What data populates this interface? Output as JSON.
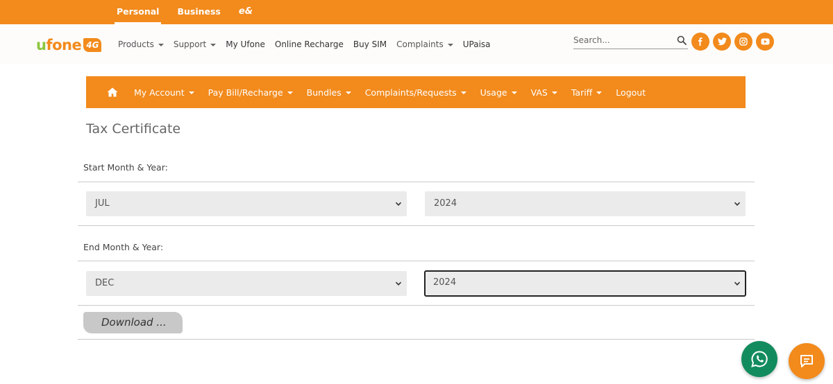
{
  "topbar": {
    "tabs": [
      {
        "label": "Personal"
      },
      {
        "label": "Business"
      },
      {
        "label": "e&"
      }
    ]
  },
  "header": {
    "logo": {
      "text_u": "u",
      "text_rest": "fone",
      "badge": "4G"
    },
    "nav": [
      {
        "label": "Products",
        "dropdown": true
      },
      {
        "label": "Support",
        "dropdown": true
      },
      {
        "label": "My Ufone",
        "dropdown": false
      },
      {
        "label": "Online Recharge",
        "dropdown": false
      },
      {
        "label": "Buy SIM",
        "dropdown": false
      },
      {
        "label": "Complaints",
        "dropdown": true
      },
      {
        "label": "UPaisa",
        "dropdown": false
      }
    ],
    "search": {
      "placeholder": "Search...",
      "icon": "search-icon"
    },
    "social": [
      "facebook-icon",
      "twitter-icon",
      "instagram-icon",
      "youtube-icon"
    ]
  },
  "account_nav": {
    "home_icon": "home-icon",
    "items": [
      {
        "label": "My Account",
        "dropdown": true
      },
      {
        "label": "Pay Bill/Recharge",
        "dropdown": true
      },
      {
        "label": "Bundles",
        "dropdown": true
      },
      {
        "label": "Complaints/Requests",
        "dropdown": true
      },
      {
        "label": "Usage",
        "dropdown": true
      },
      {
        "label": "VAS",
        "dropdown": true
      },
      {
        "label": "Tariff",
        "dropdown": true
      },
      {
        "label": "Logout",
        "dropdown": false
      }
    ]
  },
  "page": {
    "title": "Tax Certificate",
    "start_label": "Start Month & Year:",
    "start_month": "JUL",
    "start_year": "2024",
    "end_label": "End Month & Year:",
    "end_month": "DEC",
    "end_year": "2024",
    "download_label": "Download ..."
  },
  "colors": {
    "brand_orange": "#f28a1c",
    "whatsapp_green": "#128c5e",
    "logo_green": "#8dc63f"
  },
  "floating": {
    "whatsapp_icon": "whatsapp-icon",
    "chat_icon": "chat-icon"
  }
}
